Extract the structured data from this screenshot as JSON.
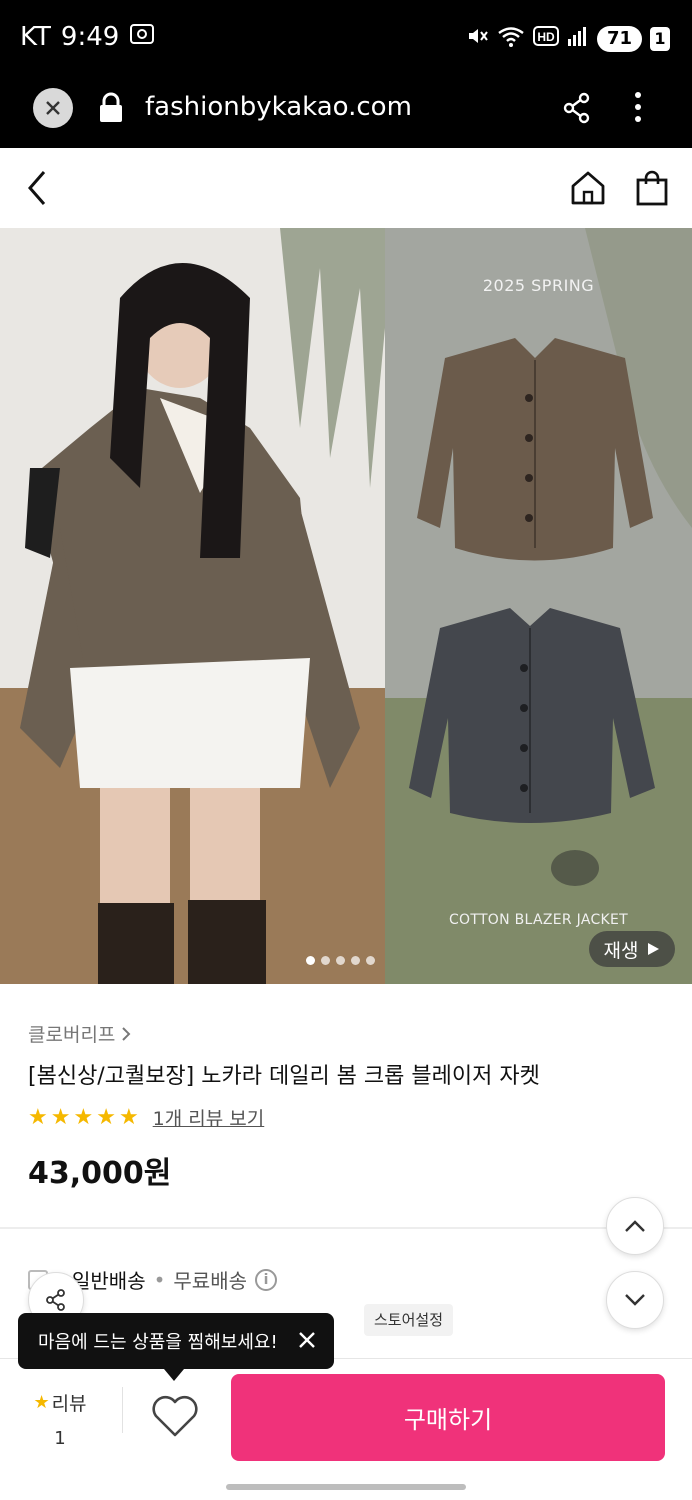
{
  "status_bar": {
    "carrier": "KT",
    "time": "9:49",
    "battery": "71",
    "sim_indicator": "1"
  },
  "browser": {
    "url": "fashionbykakao.com"
  },
  "hero": {
    "season_text": "2025 SPRING",
    "caption": "COTTON BLAZER JACKET",
    "play_label": "재생",
    "slide_count": 5,
    "active_slide": 1
  },
  "product": {
    "brand": "클로버리프",
    "title": "[봄신상/고퀄보장] 노카라 데일리 봄 크롭 블레이저 자켓",
    "rating_stars": 5,
    "review_link": "1개 리뷰 보기",
    "price": "43,000원"
  },
  "shipping": {
    "type": "일반배송",
    "separator": "•",
    "fee": "무료배송",
    "sub_text": "",
    "store_chip": "스토어설정"
  },
  "tooltip": {
    "text": "마음에 드는 상품을 찜해보세요!"
  },
  "bottom_bar": {
    "review_label": "리뷰",
    "review_count": "1",
    "buy_label": "구매하기"
  },
  "colors": {
    "accent": "#f0327a",
    "star": "#f5b800"
  }
}
